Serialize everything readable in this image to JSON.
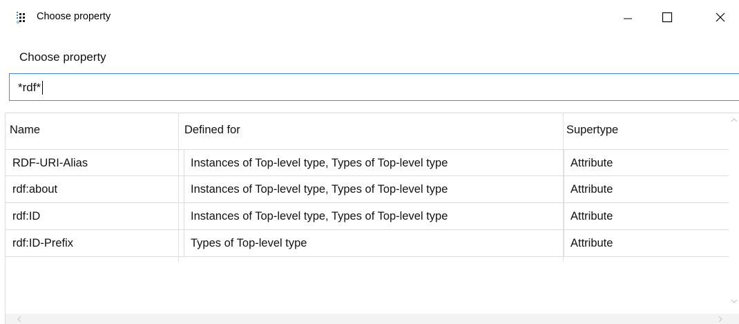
{
  "window": {
    "title": "Choose property",
    "icon": "app-dots-icon",
    "controls": {
      "minimize": "minimize-icon",
      "maximize": "maximize-icon",
      "close": "close-icon"
    }
  },
  "search": {
    "label": "Choose property",
    "value": "*rdf*"
  },
  "table": {
    "columns": [
      "Name",
      "Defined for",
      "Supertype"
    ],
    "rows": [
      {
        "name": "RDF-URI-Alias",
        "defined_for": "Instances of Top-level type, Types of Top-level type",
        "supertype": "Attribute"
      },
      {
        "name": "rdf:about",
        "defined_for": "Instances of Top-level type, Types of Top-level type",
        "supertype": "Attribute"
      },
      {
        "name": "rdf:ID",
        "defined_for": "Instances of Top-level type, Types of Top-level type",
        "supertype": "Attribute"
      },
      {
        "name": "rdf:ID-Prefix",
        "defined_for": "Types of Top-level type",
        "supertype": "Attribute"
      }
    ]
  },
  "colors": {
    "accent_border": "#3b8fd6",
    "grid_line": "#dcdcdc"
  }
}
